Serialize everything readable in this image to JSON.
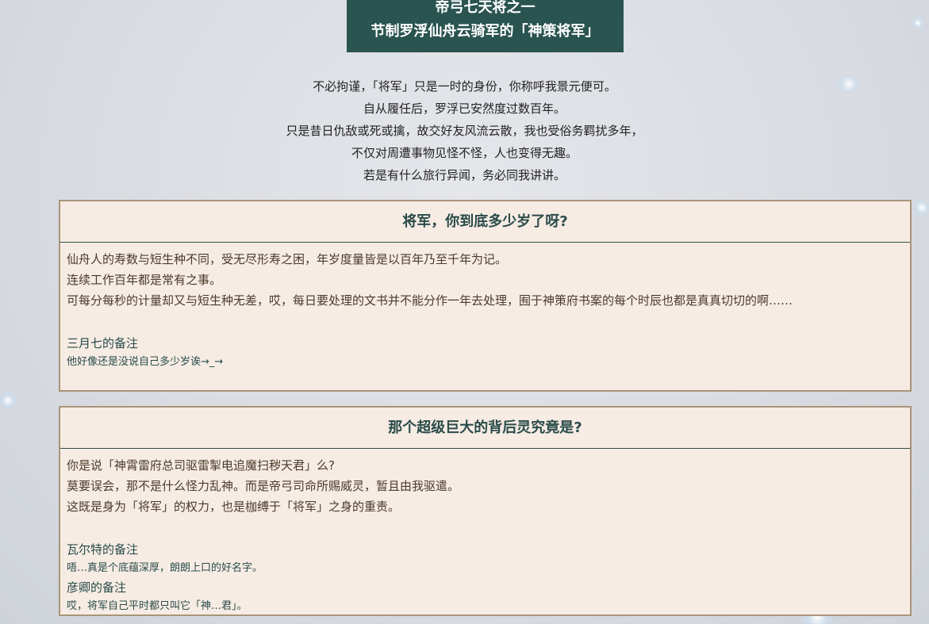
{
  "banner": {
    "line1": "帝弓七天将之一",
    "line2": "节制罗浮仙舟云骑军的「神策将军」"
  },
  "intro": [
    "不必拘谨，「将军」只是一时的身份，你称呼我景元便可。",
    "自从履任后，罗浮已安然度过数百年。",
    "只是昔日仇敌或死或擒，故交好友风流云散，我也受俗务羁扰多年，",
    "不仅对周遭事物见怪不怪，人也变得无趣。",
    "若是有什么旅行异闻，务必同我讲讲。"
  ],
  "cards": [
    {
      "question": "将军，你到底多少岁了呀?",
      "answer": [
        "仙舟人的寿数与短生种不同，受无尽形寿之困，年岁度量皆是以百年乃至千年为记。",
        "连续工作百年都是常有之事。",
        "可每分每秒的计量却又与短生种无差，哎，每日要处理的文书并不能分作一年去处理，囿于神策府书案的每个时辰也都是真真切切的啊……"
      ],
      "notes": [
        {
          "title": "三月七的备注",
          "text": "他好像还是没说自己多少岁诶→_→"
        }
      ]
    },
    {
      "question": "那个超级巨大的背后灵究竟是?",
      "answer": [
        "你是说「神霄雷府总司驱雷掣电追魔扫秽天君」么?",
        "莫要误会，那不是什么怪力乱神。而是帝弓司命所赐威灵，暂且由我驱遣。",
        "这既是身为「将军」的权力，也是枷缚于「将军」之身的重责。"
      ],
      "notes": [
        {
          "title": "瓦尔特的备注",
          "text": "唔…真是个底蕴深厚，朗朗上口的好名字。"
        },
        {
          "title": "彦卿的备注",
          "text": "哎，将军自己平时都只叫它「神…君」。"
        }
      ]
    }
  ]
}
